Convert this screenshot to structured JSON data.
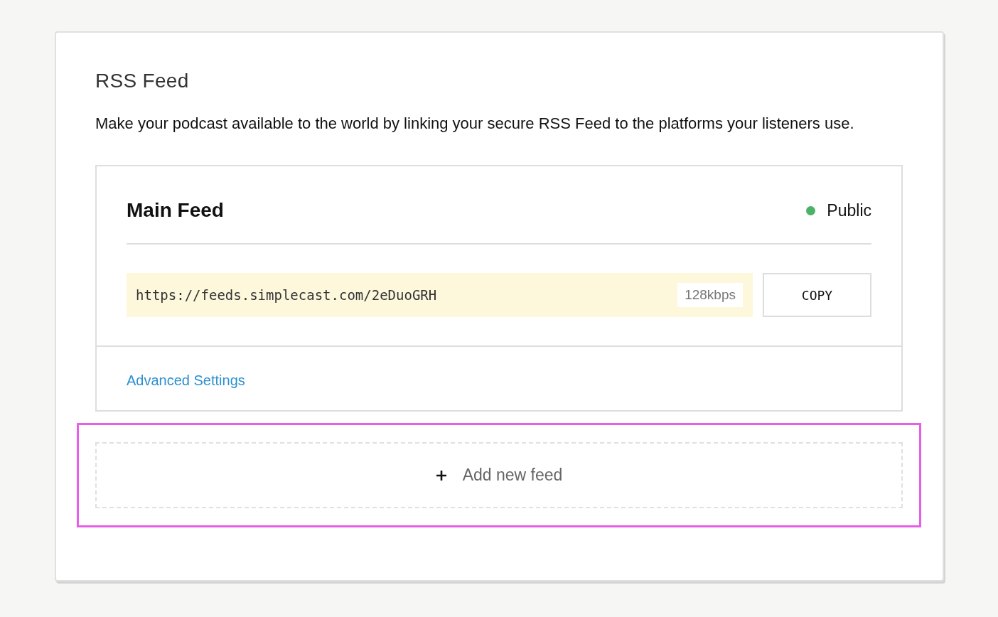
{
  "section": {
    "title": "RSS Feed",
    "description": "Make your podcast available to the world by linking your secure RSS Feed to the platforms your listeners use."
  },
  "feeds": [
    {
      "name": "Main Feed",
      "status": {
        "label": "Public",
        "color": "#4cb26a"
      },
      "url": "https://feeds.simplecast.com/2eDuoGRH",
      "bitrate": "128kbps",
      "copy_button": "COPY",
      "settings_link": "Advanced Settings"
    }
  ],
  "add_feed": {
    "label": "Add new feed",
    "highlighted": true
  }
}
